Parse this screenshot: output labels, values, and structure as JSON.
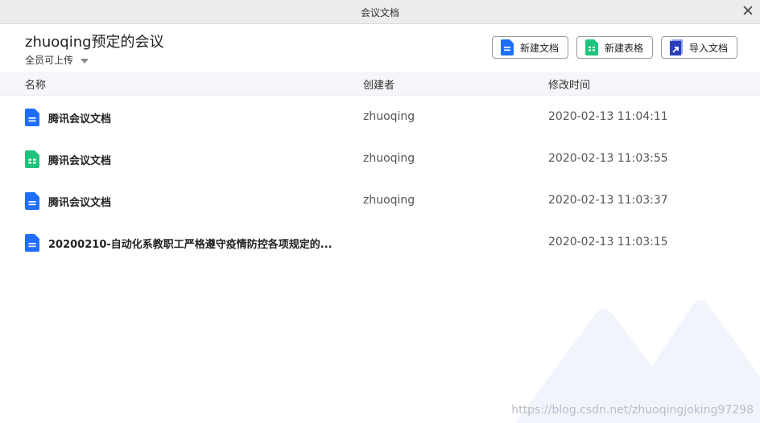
{
  "window": {
    "title": "会议文档"
  },
  "header": {
    "title": "zhuoqing预定的会议",
    "permission": "全员可上传"
  },
  "toolbar": {
    "new_doc": "新建文档",
    "new_sheet": "新建表格",
    "import_doc": "导入文档"
  },
  "columns": {
    "name": "名称",
    "creator": "创建者",
    "modified": "修改时间"
  },
  "files": [
    {
      "name": "腾讯会议文档",
      "creator": "zhuoqing",
      "modified": "2020-02-13 11:04:11",
      "type": "doc"
    },
    {
      "name": "腾讯会议文档",
      "creator": "zhuoqing",
      "modified": "2020-02-13 11:03:55",
      "type": "sheet"
    },
    {
      "name": "腾讯会议文档",
      "creator": "zhuoqing",
      "modified": "2020-02-13 11:03:37",
      "type": "doc"
    },
    {
      "name": "20200210-自动化系教职工严格遵守疫情防控各项规定的...",
      "creator": "",
      "modified": "2020-02-13 11:03:15",
      "type": "doc"
    }
  ],
  "watermark": "https://blog.csdn.net/zhuoqingjoking97298",
  "colors": {
    "doc_blue": "#1e6fff",
    "sheet_green": "#1fc47c",
    "import_navy": "#2a3fbd"
  }
}
